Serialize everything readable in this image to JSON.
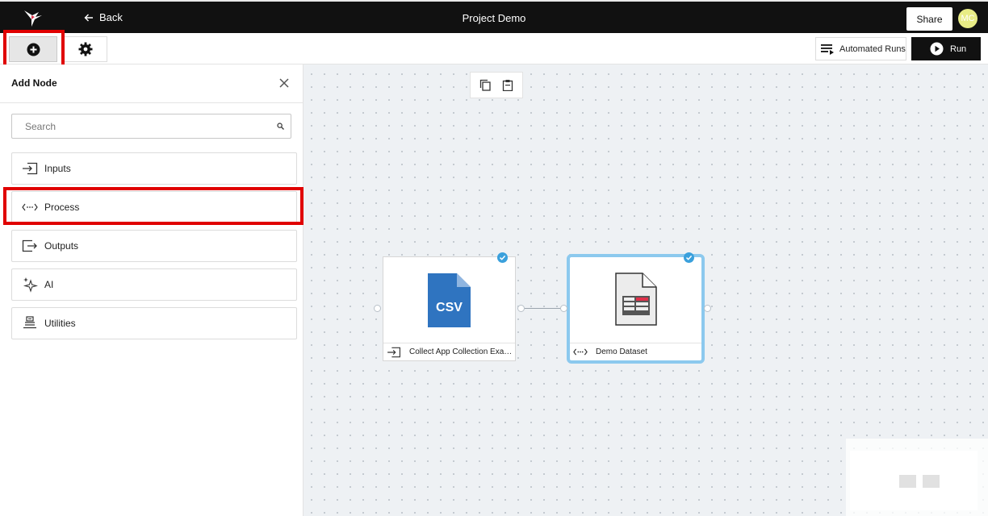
{
  "header": {
    "back_label": "Back",
    "title": "Project Demo",
    "share_label": "Share",
    "avatar_initials": "MC"
  },
  "toolbar": {
    "automated_runs_label": "Automated Runs",
    "run_label": "Run"
  },
  "sidebar": {
    "title": "Add Node",
    "search_placeholder": "Search",
    "categories": [
      {
        "label": "Inputs",
        "icon": "input-arrow-icon"
      },
      {
        "label": "Process",
        "icon": "process-code-icon"
      },
      {
        "label": "Outputs",
        "icon": "output-arrow-icon"
      },
      {
        "label": "AI",
        "icon": "sparkle-icon"
      },
      {
        "label": "Utilities",
        "icon": "utilities-icon"
      }
    ]
  },
  "canvas": {
    "nodes": [
      {
        "badge": "CSV",
        "label": "Collect App Collection Exam...",
        "type_icon": "input-arrow-icon",
        "status": "complete"
      },
      {
        "label": "Demo Dataset",
        "type_icon": "process-code-icon",
        "status": "complete",
        "selected": true
      }
    ]
  },
  "colors": {
    "topbar_bg": "#111111",
    "highlight_red": "#e00000",
    "csv_blue": "#2f74c0",
    "selection_blue": "#8cc9ee",
    "check_blue": "#3aa0dc",
    "avatar_yellow": "#e8ec86"
  }
}
